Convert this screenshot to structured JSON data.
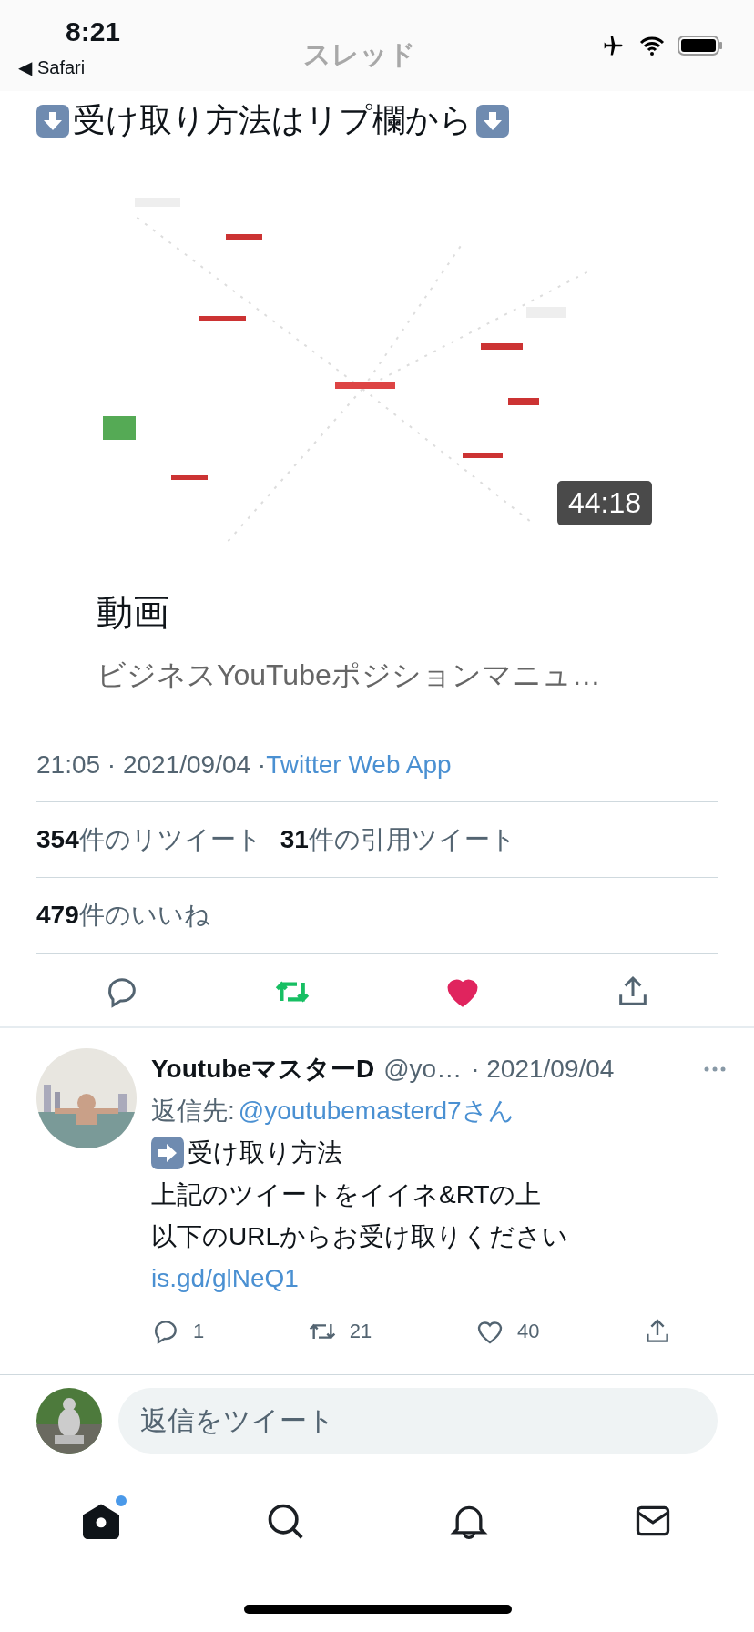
{
  "status_bar": {
    "time": "8:21",
    "back_app": "◀ Safari"
  },
  "header": {
    "title": "スレッド"
  },
  "tweet": {
    "heading": "受け取り方法はリプ欄から",
    "video": {
      "duration": "44:18",
      "title": "動画",
      "subtitle": "ビジネスYouTubeポジションマニュ…"
    },
    "timestamp": "21:05 · 2021/09/04 · ",
    "source": "Twitter Web App",
    "stats": [
      {
        "text": "**354**件のリツイート"
      },
      {
        "text": "**31**件の引用ツイート"
      }
    ],
    "likes": "**479**件のいいね",
    "actions": {
      "retweeted": true,
      "liked": true
    }
  },
  "reply": {
    "name": "YoutubeマスターD",
    "handle": "@yo…",
    "date": "· 2021/09/04",
    "reply_to_label": "返信先: ",
    "reply_to": "@youtubemasterd7さん",
    "lines": [
      "受け取り方法",
      "上記のツイートをイイネ&RTの上",
      "以下のURLからお受け取りください"
    ],
    "link": "is.gd/glNeQ1",
    "actions": [
      {
        "kind": "reply",
        "count": "1"
      },
      {
        "kind": "retweet",
        "count": "21"
      },
      {
        "kind": "like",
        "count": "40"
      },
      {
        "kind": "share"
      }
    ]
  },
  "composer": {
    "placeholder": "返信をツイート"
  },
  "tab_bar": [
    {
      "kind": "home",
      "selected": true,
      "badge": true
    },
    {
      "kind": "search",
      "selected": false,
      "badge": false
    },
    {
      "kind": "notifications",
      "selected": false,
      "badge": false
    },
    {
      "kind": "messages",
      "selected": false,
      "badge": false
    }
  ]
}
